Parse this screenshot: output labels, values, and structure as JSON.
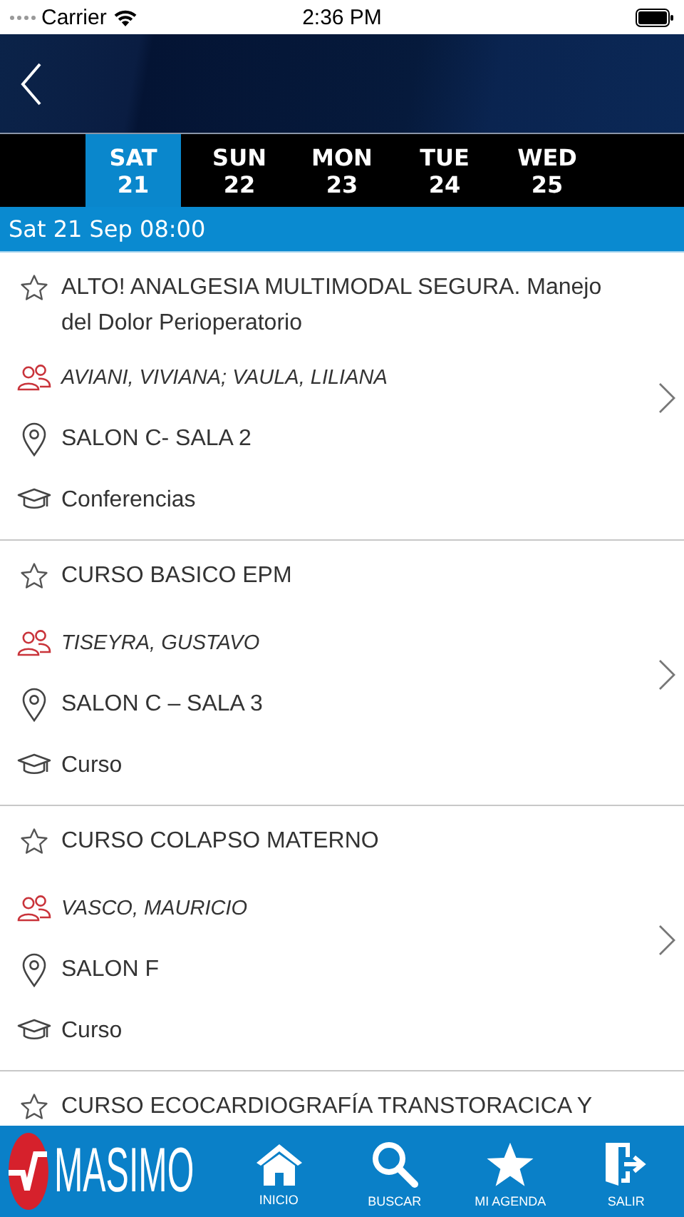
{
  "status_bar": {
    "carrier": "Carrier",
    "time": "2:36 PM"
  },
  "day_tabs": [
    {
      "day": "SAT",
      "date": "21",
      "selected": true
    },
    {
      "day": "SUN",
      "date": "22",
      "selected": false
    },
    {
      "day": "MON",
      "date": "23",
      "selected": false
    },
    {
      "day": "TUE",
      "date": "24",
      "selected": false
    },
    {
      "day": "WED",
      "date": "25",
      "selected": false
    }
  ],
  "section_header": "Sat 21 Sep 08:00",
  "sessions": [
    {
      "title": "ALTO! ANALGESIA MULTIMODAL SEGURA. Manejo del Dolor Perioperatorio",
      "speakers": "AVIANI, VIVIANA; VAULA, LILIANA",
      "room": "SALON C- SALA 2",
      "type": "Conferencias",
      "favorite": false
    },
    {
      "title": "CURSO BASICO EPM",
      "speakers": "TISEYRA, GUSTAVO",
      "room": "SALON C – SALA 3",
      "type": "Curso",
      "favorite": false
    },
    {
      "title": "CURSO COLAPSO MATERNO",
      "speakers": "VASCO, MAURICIO",
      "room": "SALON F",
      "type": "Curso",
      "favorite": false
    },
    {
      "title": "CURSO ECOCARDIOGRAFÍA TRANSTORACICA Y",
      "favorite": false
    }
  ],
  "tab_bar": {
    "logo_text": "MASIMO",
    "items": [
      {
        "label": "INICIO"
      },
      {
        "label": "BUSCAR"
      },
      {
        "label": "MI AGENDA"
      },
      {
        "label": "SALIR"
      }
    ]
  }
}
